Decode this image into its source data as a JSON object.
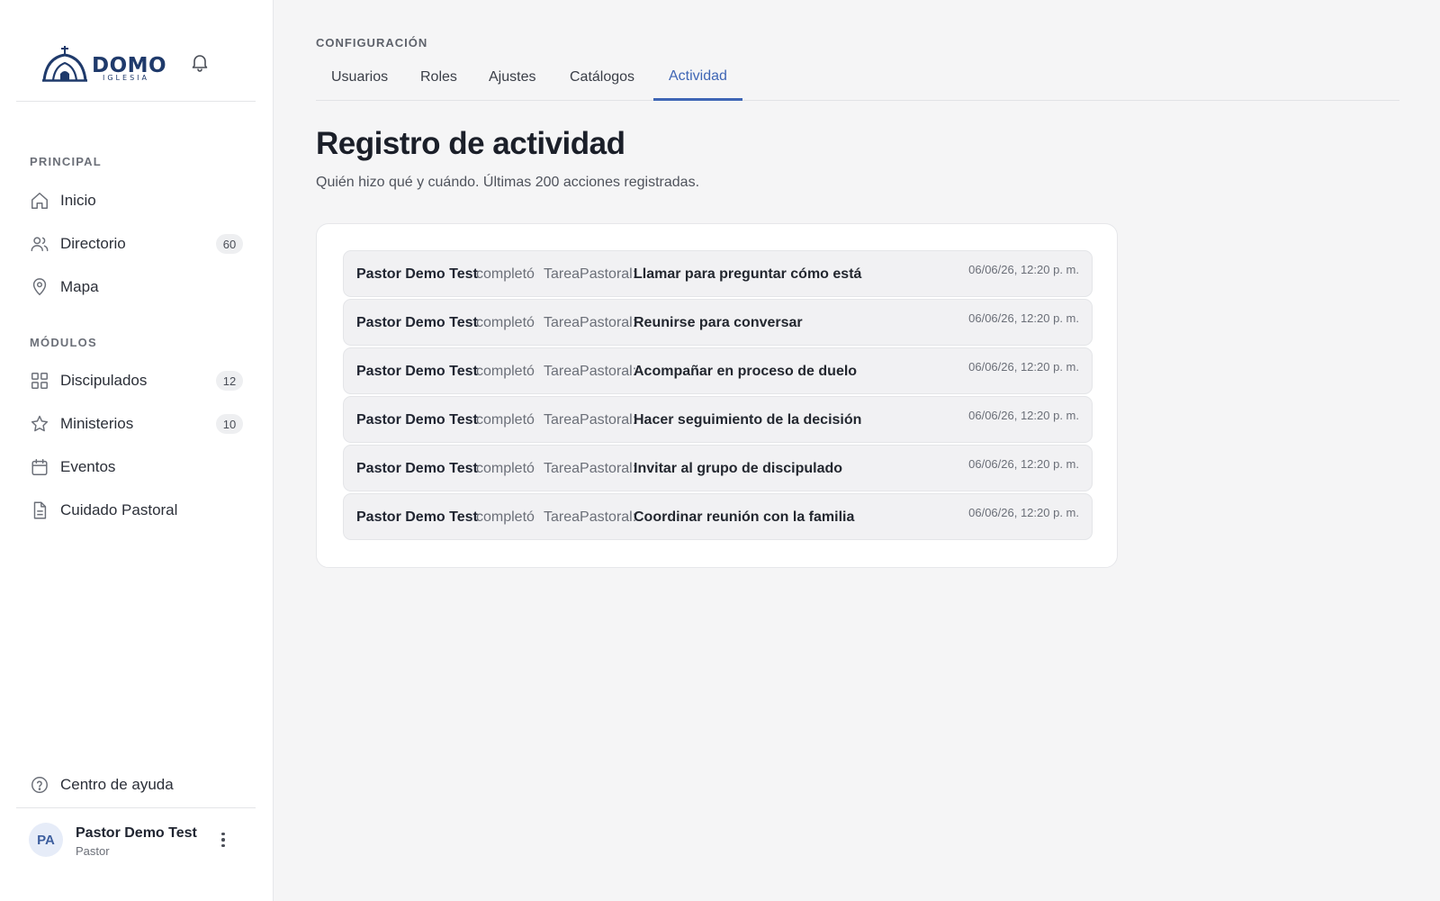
{
  "brand": {
    "name": "DOMO",
    "sub": "IGLESIA"
  },
  "sidebar": {
    "sections": [
      {
        "label": "PRINCIPAL"
      },
      {
        "label": "MÓDULOS"
      }
    ],
    "items": [
      {
        "label": "Inicio",
        "icon": "home-icon"
      },
      {
        "label": "Directorio",
        "icon": "users-icon",
        "badge": "60"
      },
      {
        "label": "Mapa",
        "icon": "map-pin-icon"
      },
      {
        "label": "Discipulados",
        "icon": "grid-icon",
        "badge": "12"
      },
      {
        "label": "Ministerios",
        "icon": "star-icon",
        "badge": "10"
      },
      {
        "label": "Eventos",
        "icon": "calendar-icon"
      },
      {
        "label": "Cuidado Pastoral",
        "icon": "document-icon"
      }
    ],
    "help": {
      "label": "Centro de ayuda",
      "icon": "help-circle-icon"
    },
    "user": {
      "initials": "PA",
      "name": "Pastor Demo Test",
      "role": "Pastor"
    }
  },
  "header": {
    "eyebrow": "CONFIGURACIÓN",
    "tabs": [
      {
        "label": "Usuarios",
        "active": false
      },
      {
        "label": "Roles",
        "active": false
      },
      {
        "label": "Ajustes",
        "active": false
      },
      {
        "label": "Catálogos",
        "active": false
      },
      {
        "label": "Actividad",
        "active": true
      }
    ]
  },
  "main": {
    "title": "Registro de actividad",
    "subtitle": "Quién hizo qué y cuándo. Últimas 200 acciones registradas.",
    "activity": [
      {
        "actor": "Pastor Demo Test",
        "verb": "completó",
        "entity": "TareaPastoral:",
        "target": "Llamar para preguntar cómo está",
        "time": "06/06/26, 12:20 p. m."
      },
      {
        "actor": "Pastor Demo Test",
        "verb": "completó",
        "entity": "TareaPastoral:",
        "target": "Reunirse para conversar",
        "time": "06/06/26, 12:20 p. m."
      },
      {
        "actor": "Pastor Demo Test",
        "verb": "completó",
        "entity": "TareaPastoral:",
        "target": "Acompañar en proceso de duelo",
        "time": "06/06/26, 12:20 p. m."
      },
      {
        "actor": "Pastor Demo Test",
        "verb": "completó",
        "entity": "TareaPastoral:",
        "target": "Hacer seguimiento de la decisión",
        "time": "06/06/26, 12:20 p. m."
      },
      {
        "actor": "Pastor Demo Test",
        "verb": "completó",
        "entity": "TareaPastoral:",
        "target": "Invitar al grupo de discipulado",
        "time": "06/06/26, 12:20 p. m."
      },
      {
        "actor": "Pastor Demo Test",
        "verb": "completó",
        "entity": "TareaPastoral:",
        "target": "Coordinar reunión con la familia",
        "time": "06/06/26, 12:20 p. m."
      }
    ]
  },
  "colors": {
    "accent": "#3f66b5",
    "brand": "#1f3a6b",
    "background": "#f5f5f6"
  }
}
